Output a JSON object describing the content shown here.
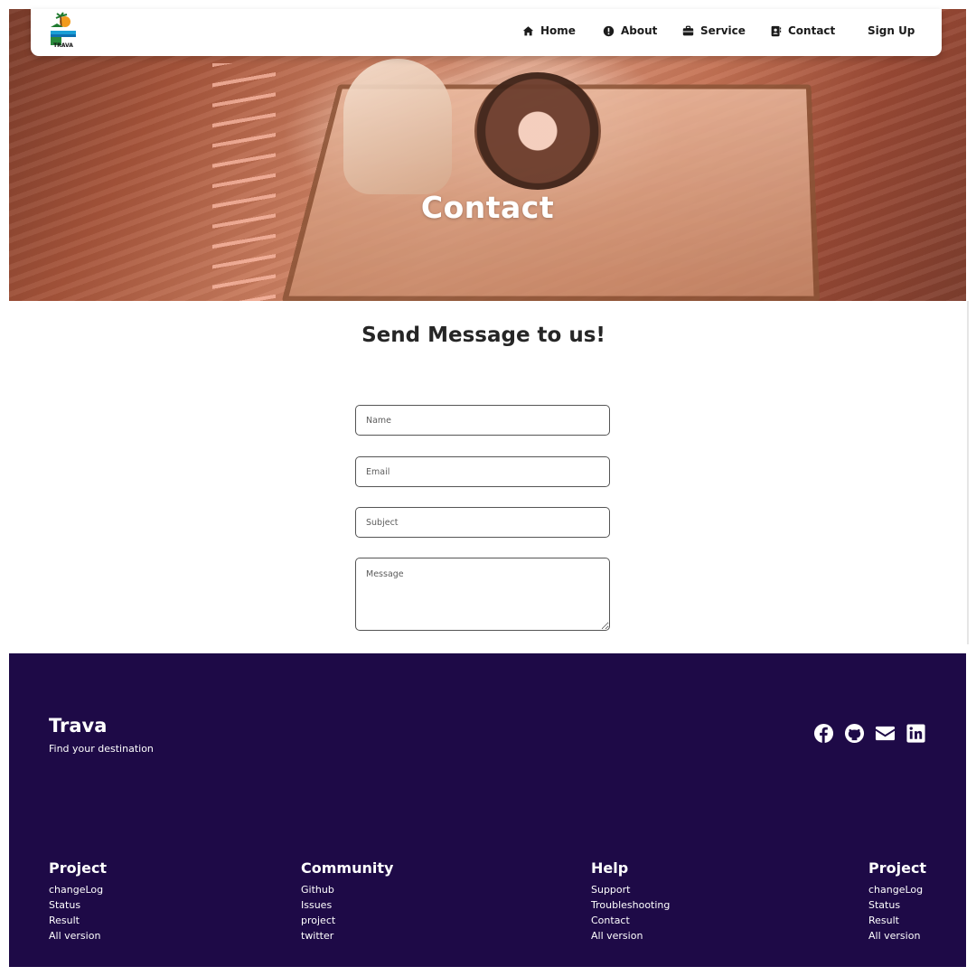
{
  "nav": {
    "logo_text": "TRAVA",
    "items": [
      {
        "label": "Home",
        "icon": "home-icon"
      },
      {
        "label": "About",
        "icon": "info-circle-icon"
      },
      {
        "label": "Service",
        "icon": "briefcase-icon"
      },
      {
        "label": "Contact",
        "icon": "address-book-icon"
      }
    ],
    "signup_label": "Sign Up"
  },
  "hero": {
    "title": "Contact"
  },
  "form": {
    "heading": "Send Message to us!",
    "name_placeholder": "Name",
    "email_placeholder": "Email",
    "subject_placeholder": "Subject",
    "message_placeholder": "Message",
    "name_value": "",
    "email_value": "",
    "subject_value": "",
    "message_value": ""
  },
  "footer": {
    "brand": "Trava",
    "tagline": "Find your destination",
    "social_icons": [
      "facebook-icon",
      "github-icon",
      "envelope-icon",
      "linkedin-icon"
    ],
    "columns": [
      {
        "title": "Project",
        "links": [
          "changeLog",
          "Status",
          "Result",
          "All version"
        ]
      },
      {
        "title": "Community",
        "links": [
          "Github",
          "Issues",
          "project",
          "twitter"
        ]
      },
      {
        "title": "Help",
        "links": [
          "Support",
          "Troubleshooting",
          "Contact",
          "All version"
        ]
      },
      {
        "title": "Project",
        "links": [
          "changeLog",
          "Status",
          "Result",
          "All version"
        ]
      }
    ]
  },
  "colors": {
    "footer_bg": "#1e0a47",
    "nav_bg": "#ffffff",
    "text_dark": "#1b1b1b"
  }
}
